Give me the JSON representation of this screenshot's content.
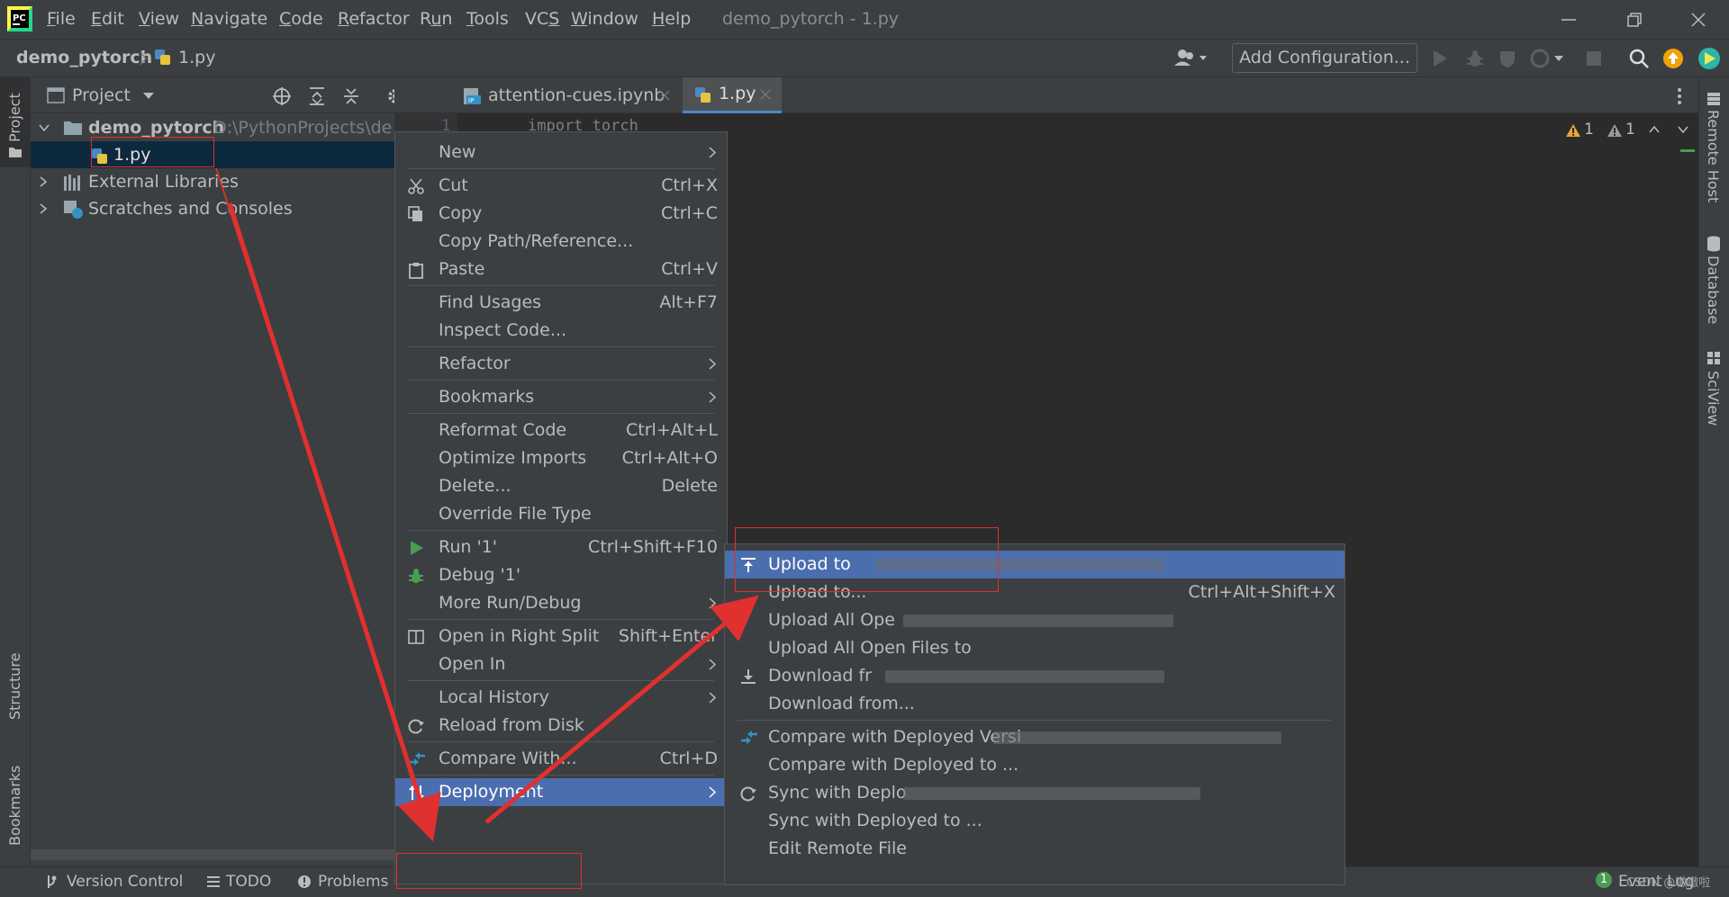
{
  "window": {
    "title": "demo_pytorch - 1.py",
    "menu": [
      {
        "pre": "",
        "mn": "F",
        "post": "ile"
      },
      {
        "pre": "",
        "mn": "E",
        "post": "dit"
      },
      {
        "pre": "",
        "mn": "V",
        "post": "iew"
      },
      {
        "pre": "",
        "mn": "N",
        "post": "avigate"
      },
      {
        "pre": "",
        "mn": "C",
        "post": "ode"
      },
      {
        "pre": "",
        "mn": "R",
        "post": "efactor"
      },
      {
        "pre": "R",
        "mn": "u",
        "post": "n"
      },
      {
        "pre": "",
        "mn": "T",
        "post": "ools"
      },
      {
        "pre": "VC",
        "mn": "S",
        "post": ""
      },
      {
        "pre": "",
        "mn": "W",
        "post": "indow"
      },
      {
        "pre": "",
        "mn": "H",
        "post": "elp"
      }
    ]
  },
  "navbar": {
    "project": "demo_pytorch",
    "file": "1.py",
    "run_config": "Add Configuration..."
  },
  "stripes": {
    "left_top": "Project",
    "left_structure": "Structure",
    "left_bookmarks": "Bookmarks",
    "right": [
      "Remote Host",
      "Database",
      "SciView"
    ]
  },
  "project_panel": {
    "title": "Project",
    "root_name": "demo_pytorch",
    "root_path": "D:\\PythonProjects\\demo_pytorch",
    "items": [
      "1.py",
      "External Libraries",
      "Scratches and Consoles"
    ]
  },
  "editor": {
    "tabs": [
      "attention-cues.ipynb",
      "1.py"
    ],
    "line_number": "1",
    "code_line": "import torch",
    "warnings": [
      "1",
      "1"
    ]
  },
  "statusbar": {
    "items": [
      "Version Control",
      "TODO",
      "Problems"
    ],
    "event_log": "Event Log",
    "event_count": "1",
    "watermark": "CSDN @嗷嗷啦"
  },
  "context_menu": {
    "items": [
      {
        "label": "New",
        "shortcut": "",
        "submenu": true
      },
      {
        "label": "Cut",
        "shortcut": "Ctrl+X"
      },
      {
        "label": "Copy",
        "shortcut": "Ctrl+C"
      },
      {
        "label": "Copy Path/Reference...",
        "shortcut": ""
      },
      {
        "label": "Paste",
        "shortcut": "Ctrl+V"
      },
      {
        "label": "Find Usages",
        "shortcut": "Alt+F7"
      },
      {
        "label": "Inspect Code...",
        "shortcut": ""
      },
      {
        "label": "Refactor",
        "shortcut": "",
        "submenu": true
      },
      {
        "label": "Bookmarks",
        "shortcut": "",
        "submenu": true
      },
      {
        "label": "Reformat Code",
        "shortcut": "Ctrl+Alt+L"
      },
      {
        "label": "Optimize Imports",
        "shortcut": "Ctrl+Alt+O"
      },
      {
        "label": "Delete...",
        "shortcut": "Delete"
      },
      {
        "label": "Override File Type",
        "shortcut": ""
      },
      {
        "label": "Run '1'",
        "shortcut": "Ctrl+Shift+F10"
      },
      {
        "label": "Debug '1'",
        "shortcut": ""
      },
      {
        "label": "More Run/Debug",
        "shortcut": "",
        "submenu": true
      },
      {
        "label": "Open in Right Split",
        "shortcut": "Shift+Enter"
      },
      {
        "label": "Open In",
        "shortcut": "",
        "submenu": true
      },
      {
        "label": "Local History",
        "shortcut": "",
        "submenu": true
      },
      {
        "label": "Reload from Disk",
        "shortcut": ""
      },
      {
        "label": "Compare With...",
        "shortcut": "Ctrl+D"
      },
      {
        "label": "Deployment",
        "shortcut": "",
        "submenu": true,
        "selected": true
      }
    ]
  },
  "deployment_menu": {
    "items": [
      {
        "label": "Upload to",
        "shortcut": "",
        "selected": true
      },
      {
        "label": "Upload to...",
        "shortcut": "Ctrl+Alt+Shift+X"
      },
      {
        "label": "Upload All Ope",
        "shortcut": ""
      },
      {
        "label": "Upload All Open Files to",
        "shortcut": ""
      },
      {
        "label": "Download fr",
        "shortcut": ""
      },
      {
        "label": "Download from...",
        "shortcut": ""
      },
      {
        "label": "Compare with Deployed Versi",
        "shortcut": ""
      },
      {
        "label": "Compare with Deployed to ...",
        "shortcut": ""
      },
      {
        "label": "Sync with Deplo",
        "shortcut": ""
      },
      {
        "label": "Sync with Deployed to ...",
        "shortcut": ""
      },
      {
        "label": "Edit Remote File",
        "shortcut": ""
      }
    ]
  },
  "colors": {
    "background": "#2b2b2b",
    "panel": "#3c3f41",
    "selection": "#4b6eaf",
    "annotation": "#e03030",
    "run_green": "#499c54",
    "warning": "#e8a33d"
  }
}
